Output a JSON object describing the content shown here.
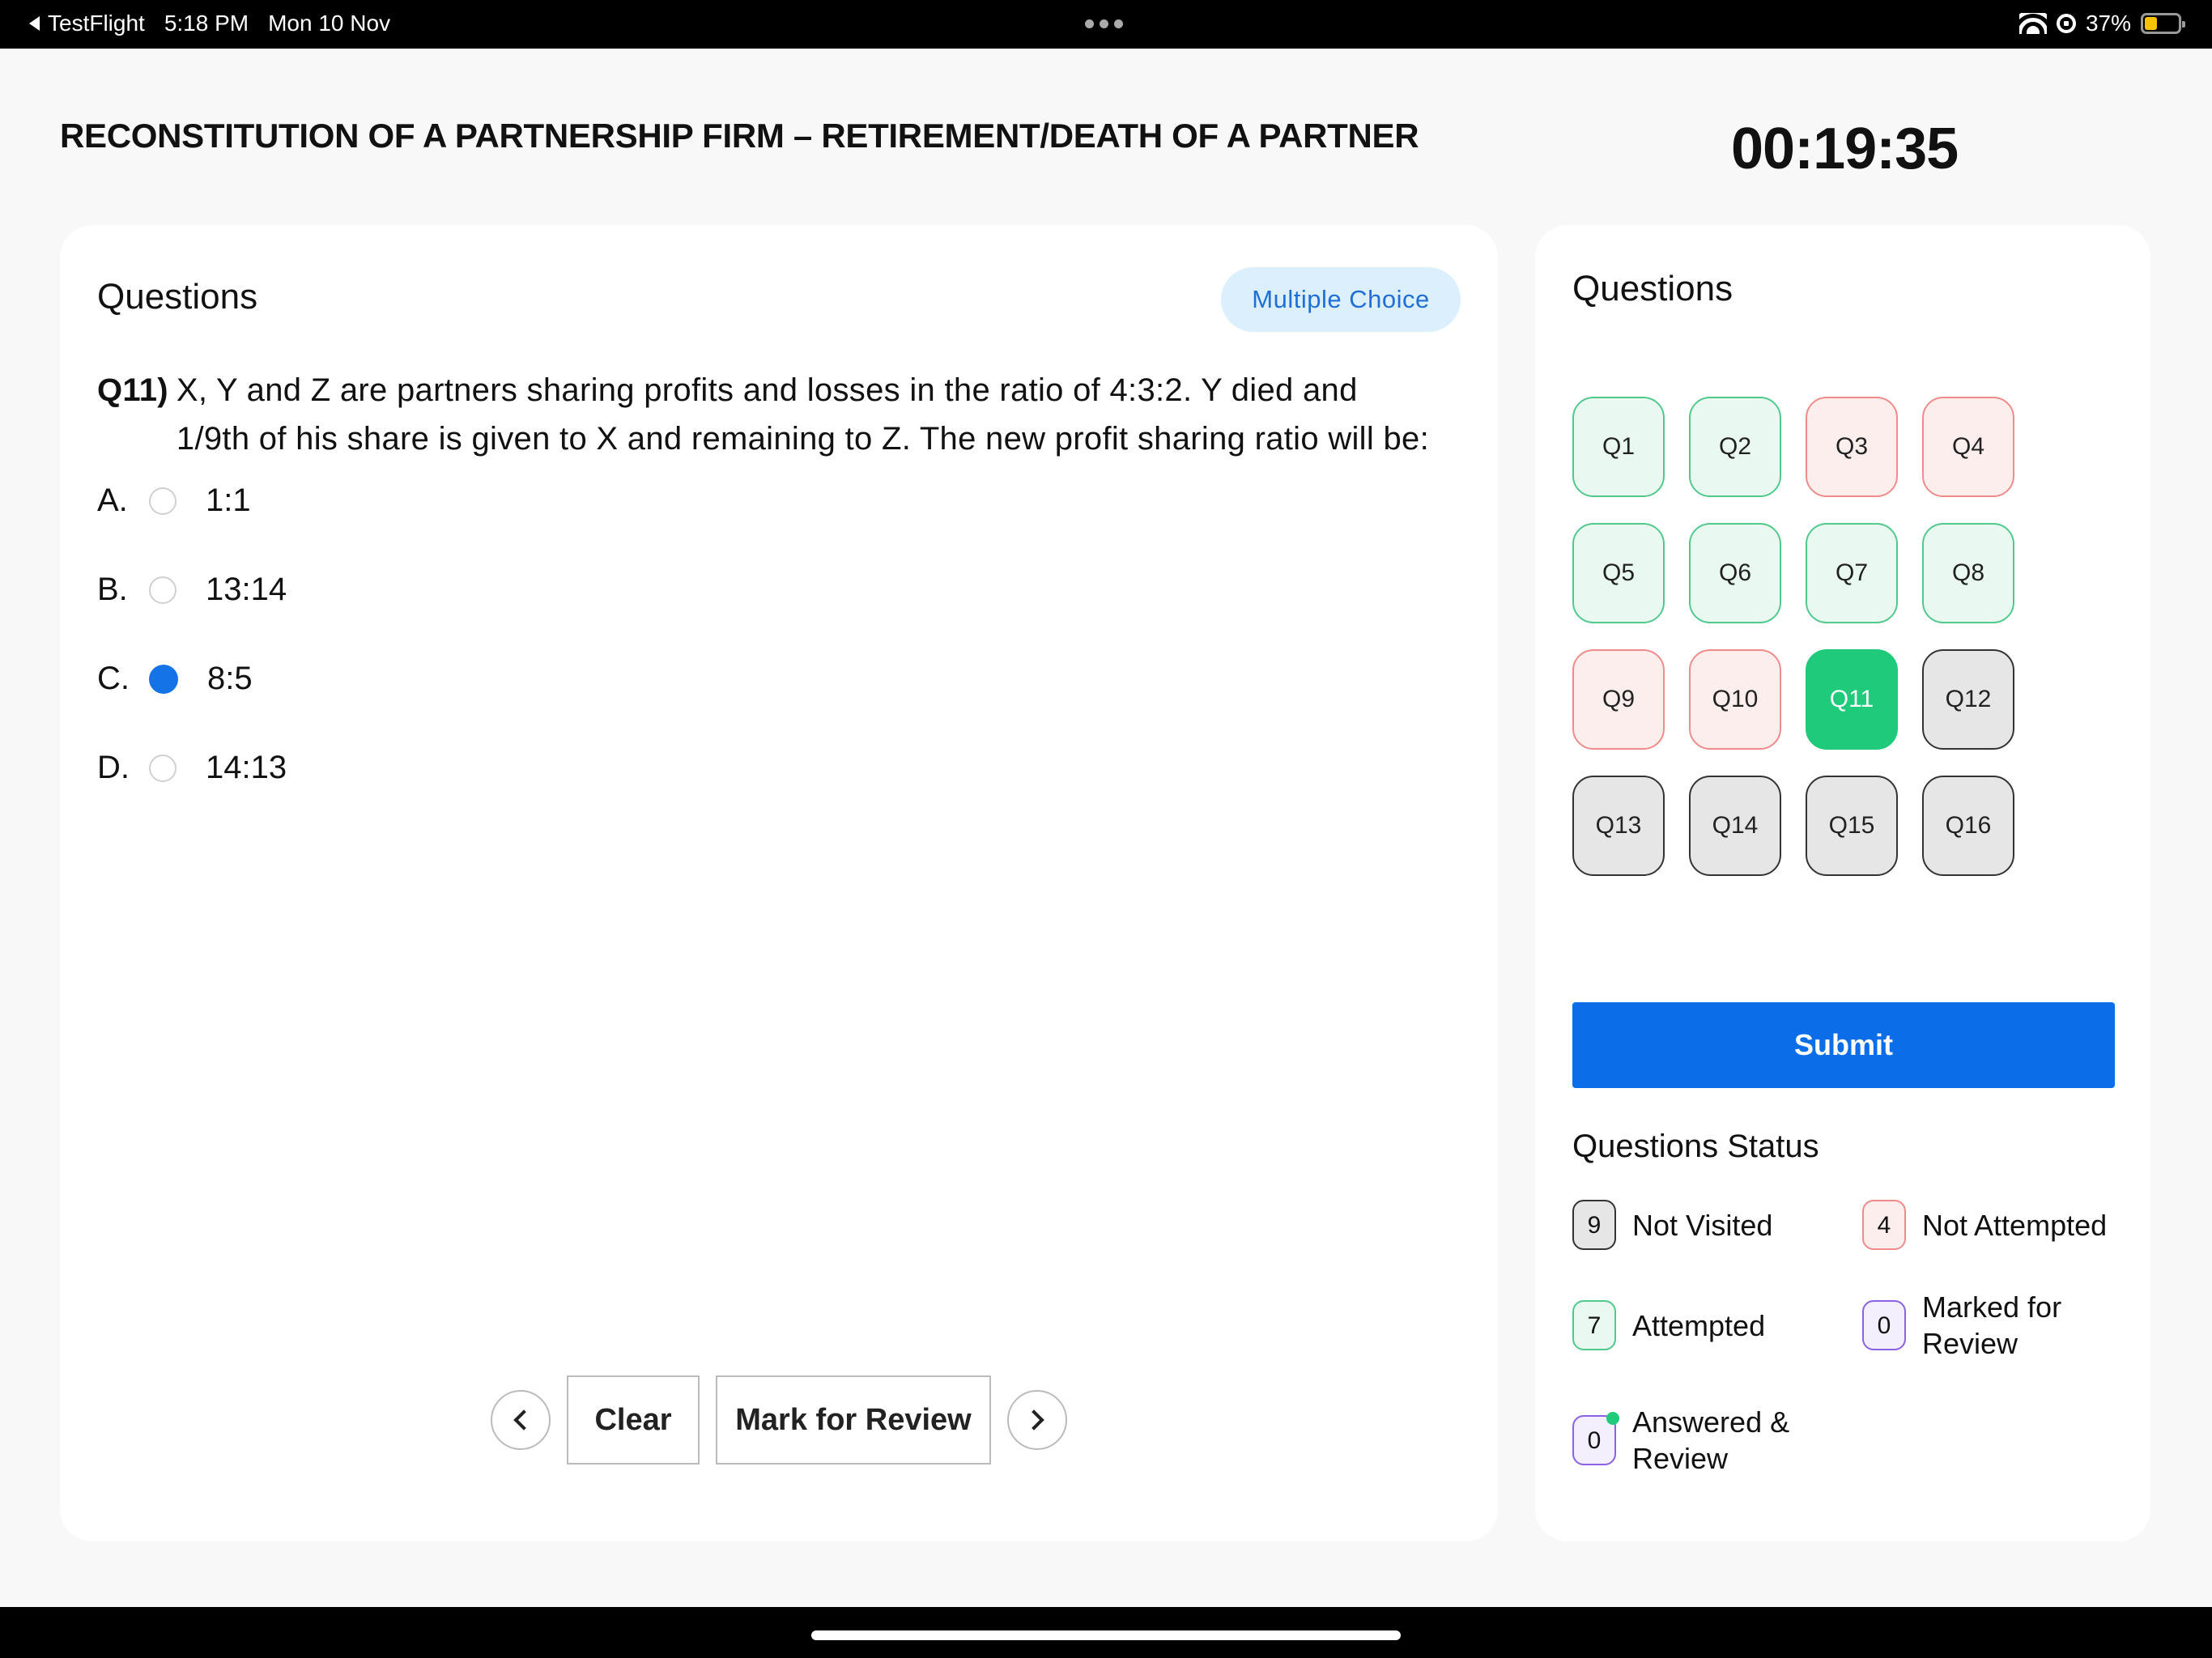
{
  "status_bar": {
    "back_app": "TestFlight",
    "time": "5:18 PM",
    "date": "Mon 10 Nov",
    "battery": "37%",
    "battery_level": 0.37,
    "icons": [
      "wifi-icon",
      "orientation-lock-icon",
      "battery-icon"
    ]
  },
  "header": {
    "title": "RECONSTITUTION OF A PARTNERSHIP FIRM – RETIREMENT/DEATH OF A PARTNER",
    "timer": "00:19:35"
  },
  "question_panel": {
    "title": "Questions",
    "type_badge": "Multiple Choice",
    "number": "Q11)",
    "text": "X, Y and Z are partners sharing profits and losses in the ratio of 4:3:2. Y died and 1/9th of his share is given to X and remaining to Z. The new profit sharing ratio will be:",
    "options": [
      {
        "letter": "A.",
        "text": "1:1",
        "selected": false
      },
      {
        "letter": "B.",
        "text": "13:14",
        "selected": false
      },
      {
        "letter": "C.",
        "text": "8:5",
        "selected": true
      },
      {
        "letter": "D.",
        "text": "14:13",
        "selected": false
      }
    ],
    "buttons": {
      "clear": "Clear",
      "mark_review": "Mark for Review"
    }
  },
  "navigator": {
    "title": "Questions",
    "questions": [
      {
        "label": "Q1",
        "status": "attempted"
      },
      {
        "label": "Q2",
        "status": "attempted"
      },
      {
        "label": "Q3",
        "status": "not-attempted"
      },
      {
        "label": "Q4",
        "status": "not-attempted"
      },
      {
        "label": "Q5",
        "status": "attempted"
      },
      {
        "label": "Q6",
        "status": "attempted"
      },
      {
        "label": "Q7",
        "status": "attempted"
      },
      {
        "label": "Q8",
        "status": "attempted"
      },
      {
        "label": "Q9",
        "status": "not-attempted"
      },
      {
        "label": "Q10",
        "status": "not-attempted"
      },
      {
        "label": "Q11",
        "status": "current"
      },
      {
        "label": "Q12",
        "status": "not-visited"
      },
      {
        "label": "Q13",
        "status": "not-visited"
      },
      {
        "label": "Q14",
        "status": "not-visited"
      },
      {
        "label": "Q15",
        "status": "not-visited"
      },
      {
        "label": "Q16",
        "status": "not-visited"
      }
    ],
    "submit": "Submit",
    "status_title": "Questions Status",
    "legend": {
      "not_visited": {
        "count": "9",
        "label": "Not Visited"
      },
      "not_attempted": {
        "count": "4",
        "label": "Not Attempted"
      },
      "attempted": {
        "count": "7",
        "label": "Attempted"
      },
      "marked_review": {
        "count": "0",
        "label": "Marked for Review"
      },
      "answered_review": {
        "count": "0",
        "label": "Answered & Review"
      }
    }
  },
  "colors": {
    "accent_blue": "#0b6ee8",
    "selected_radio": "#1473e6",
    "current_green": "#1fca7a",
    "attempted_border": "#52c98c",
    "not_attempted_border": "#ef8b8b",
    "marked_border": "#8b62e3"
  }
}
